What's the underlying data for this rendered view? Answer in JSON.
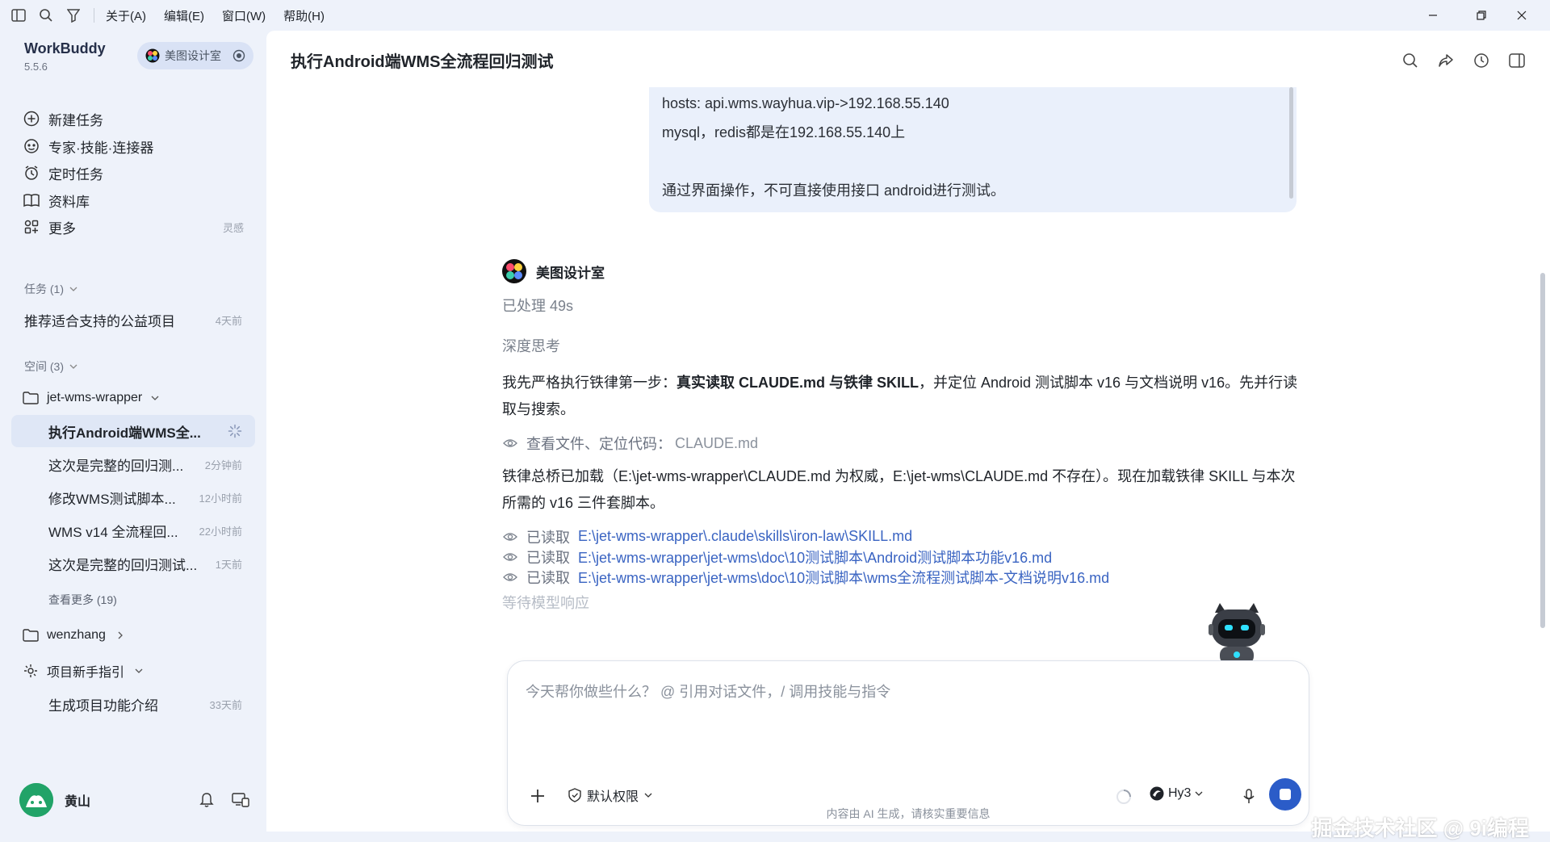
{
  "menu": [
    "关于(A)",
    "编辑(E)",
    "窗口(W)",
    "帮助(H)"
  ],
  "brand": {
    "name": "WorkBuddy",
    "version": "5.5.6"
  },
  "workspace_pill": "美图设计室",
  "nav": [
    {
      "label": "新建任务",
      "icon": "plus-circle-icon"
    },
    {
      "label": "专家·技能·连接器",
      "icon": "expert-icon"
    },
    {
      "label": "定时任务",
      "icon": "alarm-icon"
    },
    {
      "label": "资料库",
      "icon": "book-icon"
    },
    {
      "label": "更多",
      "icon": "grid-icon",
      "aux": "灵感"
    }
  ],
  "tasks_section": {
    "label": "任务 (1)",
    "items": [
      {
        "label": "推荐适合支持的公益项目",
        "time": "4天前"
      }
    ]
  },
  "spaces_section": {
    "label": "空间 (3)"
  },
  "folder1": {
    "label": "jet-wms-wrapper"
  },
  "folder1_items": [
    {
      "label": "执行Android端WMS全...",
      "time": ""
    },
    {
      "label": "这次是完整的回归测...",
      "time": "2分钟前"
    },
    {
      "label": "修改WMS测试脚本...",
      "time": "12小时前"
    },
    {
      "label": "WMS v14 全流程回...",
      "time": "22小时前"
    },
    {
      "label": "这次是完整的回归测试...",
      "time": "1天前"
    }
  ],
  "see_more": "查看更多 (19)",
  "folder2": {
    "label": "wenzhang"
  },
  "folder3": {
    "label": "项目新手指引"
  },
  "folder3_items": [
    {
      "label": "生成项目功能介绍",
      "time": "33天前"
    }
  ],
  "user": {
    "name": "黄山"
  },
  "main": {
    "title": "执行Android端WMS全流程回归测试",
    "user_msg": [
      "hosts: api.wms.wayhua.vip->192.168.55.140",
      "mysql，redis都是在192.168.55.140上",
      "",
      "通过界面操作，不可直接使用接口 android进行测试。"
    ],
    "ai_name": "美图设计室",
    "processed": "已处理 49s",
    "thinking": "深度思考",
    "p1_pre": "我先严格执行铁律第一步：",
    "p1_bold": "真实读取 CLAUDE.md 与铁律 SKILL",
    "p1_post": "，并定位 Android 测试脚本 v16 与文档说明 v16。先并行读取与搜索。",
    "tool1_label": "查看文件、定位代码：",
    "tool1_file": "CLAUDE.md",
    "p2": "铁律总桥已加载（E:\\jet-wms-wrapper\\CLAUDE.md 为权威，E:\\jet-wms\\CLAUDE.md 不存在）。现在加载铁律 SKILL 与本次所需的 v16 三件套脚本。",
    "reads": [
      {
        "label": "已读取",
        "file": "E:\\jet-wms-wrapper\\.claude\\skills\\iron-law\\SKILL.md"
      },
      {
        "label": "已读取",
        "file": "E:\\jet-wms-wrapper\\jet-wms\\doc\\10测试脚本\\Android测试脚本功能v16.md"
      },
      {
        "label": "已读取",
        "file": "E:\\jet-wms-wrapper\\jet-wms\\doc\\10测试脚本\\wms全流程测试脚本-文档说明v16.md"
      }
    ],
    "waiting": "等待模型响应"
  },
  "composer": {
    "placeholder": "今天帮你做些什么？ @ 引用对话文件，/ 调用技能与指令",
    "permission": "默认权限",
    "model": "Hy3"
  },
  "disclaimer": "内容由 AI 生成，请核实重要信息",
  "watermark": "掘金技术社区 @ 9i编程",
  "colors": {
    "accent": "#2b5cc8",
    "link": "#3a64c2",
    "sidebar_bg": "#eef2fa"
  }
}
